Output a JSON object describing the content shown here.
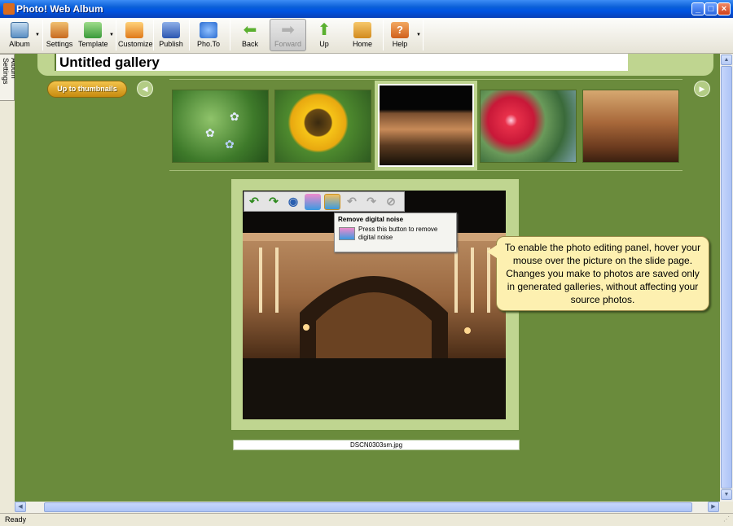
{
  "window": {
    "title": "Photo! Web Album"
  },
  "toolbar": {
    "album": "Album",
    "settings": "Settings",
    "template": "Template",
    "customize": "Customize",
    "publish": "Publish",
    "phototo": "Pho.To",
    "back": "Back",
    "forward": "Forward",
    "up": "Up",
    "home": "Home",
    "help": "Help"
  },
  "sidebar": {
    "tab": "Album Settings"
  },
  "gallery": {
    "title": "Untitled gallery",
    "up_button": "Up to thumbnails",
    "thumbnails": [
      "forget-me-not flowers",
      "sunflower",
      "palace arch at night",
      "red hibiscus",
      "colosseum at sunset"
    ],
    "selected_index": 2
  },
  "editor": {
    "tools": [
      "rotate-left",
      "rotate-right",
      "red-eye",
      "enhance",
      "remove-noise",
      "undo",
      "redo",
      "cancel"
    ],
    "tooltip": {
      "title": "Remove digital noise",
      "text": "Press this button to remove digital noise"
    }
  },
  "slide": {
    "caption": "DSCN0303sm.jpg"
  },
  "callout": {
    "text": "To enable the photo editing panel, hover your mouse over the picture on the slide page. Changes you make to photos are saved only in generated galleries, without affecting your source photos."
  },
  "status": {
    "text": "Ready"
  }
}
